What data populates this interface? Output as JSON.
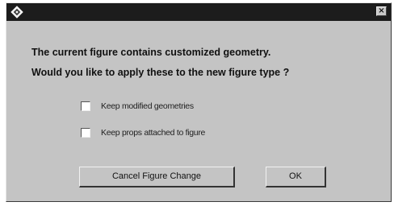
{
  "window": {
    "app_icon": "diamond-app-icon",
    "close_label": "×"
  },
  "message": {
    "line1": "The current figure contains customized geometry.",
    "line2": "Would you like to apply these to the new figure type ?"
  },
  "options": [
    {
      "label": "Keep modified geometries",
      "checked": false
    },
    {
      "label": "Keep props attached to figure",
      "checked": false
    }
  ],
  "buttons": {
    "cancel_label": "Cancel Figure Change",
    "ok_label": "OK"
  }
}
